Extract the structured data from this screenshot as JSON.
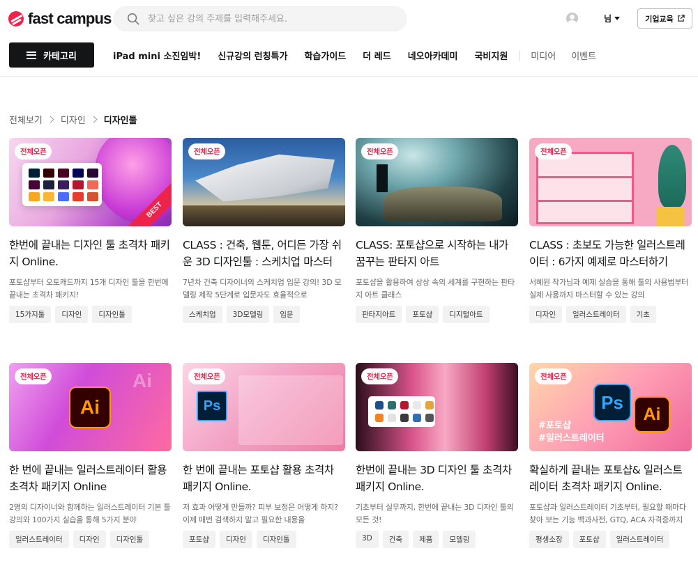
{
  "header": {
    "logo_text": "fast campus",
    "search_placeholder": "찾고 싶은 강의 주제를 입력해주세요.",
    "user_label": "님",
    "biz_button": "기업교육",
    "category_button": "카테고리",
    "nav_primary": [
      "iPad mini 소진임박!",
      "신규강의 런칭특가",
      "학습가이드",
      "더 레드",
      "네오아카데미",
      "국비지원"
    ],
    "nav_secondary": [
      "미디어",
      "이벤트"
    ]
  },
  "breadcrumb": [
    "전체보기",
    "디자인",
    "디자인툴"
  ],
  "cards": [
    {
      "badge": "전체오픈",
      "ribbon": "BEST",
      "title": "한번에 끝내는 디자인 툴 초격차 패키지 Online.",
      "desc": "포토샵부터 오토캐드까지 15개 디자인 툴을 한번에 끝내는 초격차 패키지!",
      "tags": [
        "15가지툴",
        "디자인",
        "디자인툴"
      ]
    },
    {
      "badge": "전체오픈",
      "title": "CLASS : 건축, 웹툰, 어디든 가장 쉬운 3D 디자인툴 : 스케치업 마스터",
      "desc": "7년차 건축 디자이너의 스케치업 입문 강의! 3D 모델링 제작 5단계로 입문자도 효율적으로",
      "tags": [
        "스케치업",
        "3D모델링",
        "입문"
      ]
    },
    {
      "badge": "전체오픈",
      "title": "CLASS: 포토샵으로 시작하는 내가 꿈꾸는 판타지 아트",
      "desc": "포토샵을 활용하여 상상 속의 세계를 구현하는 판타지 아트 클래스",
      "tags": [
        "판타지아트",
        "포토샵",
        "디지털아트"
      ]
    },
    {
      "badge": "전체오픈",
      "title": "CLASS : 초보도 가능한 일러스트레이터 : 6가지 예제로 마스터하기",
      "desc": "서혜원 작가님과 예제 실습을 통해 툴의 사용법부터 실제 사용까지 마스터할 수 있는 강의",
      "tags": [
        "디자인",
        "일러스트레이터",
        "기초"
      ]
    },
    {
      "badge": "전체오픈",
      "art_text": "Ai",
      "title": "한 번에 끝내는 일러스트레이터 활용 초격차 패키지 Online",
      "desc": "2명의 디자이너와 함께하는 일러스트레이터 기본 툴 강의와 100가지 실습을 통해 5가지 분야",
      "tags": [
        "일러스트레이터",
        "디자인",
        "디자인툴"
      ]
    },
    {
      "badge": "전체오픈",
      "art_text": "Ps",
      "title": "한 번에 끝내는 포토샵 활용 초격차 패키지 Online.",
      "desc": "저 효과 어떻게 만들까? 피부 보정은 어떻게 하지? 이제 매번 검색하지 말고 필요한 내용을",
      "tags": [
        "포토샵",
        "디자인",
        "디자인툴"
      ]
    },
    {
      "badge": "전체오픈",
      "title": "한번에 끝내는 3D 디자인 툴 초격차 패키지 Online.",
      "desc": "기초부터 실무까지, 한번에 끝내는 3D 디자인 툴의 모든 것!",
      "tags": [
        "3D",
        "건축",
        "제품",
        "모델링"
      ]
    },
    {
      "badge": "전체오픈",
      "art_text": [
        "Ps",
        "Ai",
        "#포토샵",
        "#일러스트레이터"
      ],
      "title": "확실하게 끝내는 포토샵& 일러스트레이터 초격차 패키지 Online.",
      "desc": "포토샵과 일러스트레이터 기초부터, 필요할 때마다 찾아 보는 기능 백과사전, GTQ, ACA 자격증까지",
      "tags": [
        "평생소장",
        "포토샵",
        "일러스트레이터"
      ]
    }
  ]
}
